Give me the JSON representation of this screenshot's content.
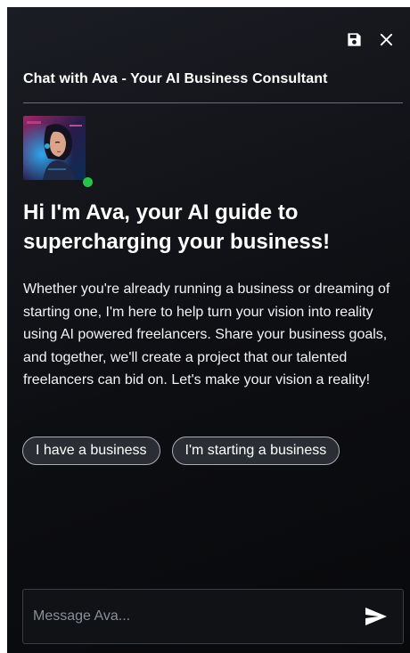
{
  "header": {
    "title": "Chat with Ava - Your AI Business Consultant",
    "save_icon": "save-icon",
    "close_icon": "close-icon"
  },
  "assistant": {
    "avatar": "ava-avatar",
    "status": "online",
    "status_color": "#27c24c"
  },
  "message": {
    "greeting": "Hi I'm Ava, your AI guide to supercharging your business!",
    "body": "Whether you're already running a business or dreaming of starting one, I'm here to help turn your vision into reality using AI powered freelancers. Share your business goals, and together, we'll create a project that our talented freelancers can bid on. Let's make your vision a reality!"
  },
  "quick_replies": [
    {
      "label": "I have a business"
    },
    {
      "label": "I'm starting a business"
    }
  ],
  "composer": {
    "placeholder": "Message Ava...",
    "value": "",
    "send_icon": "send-icon"
  }
}
